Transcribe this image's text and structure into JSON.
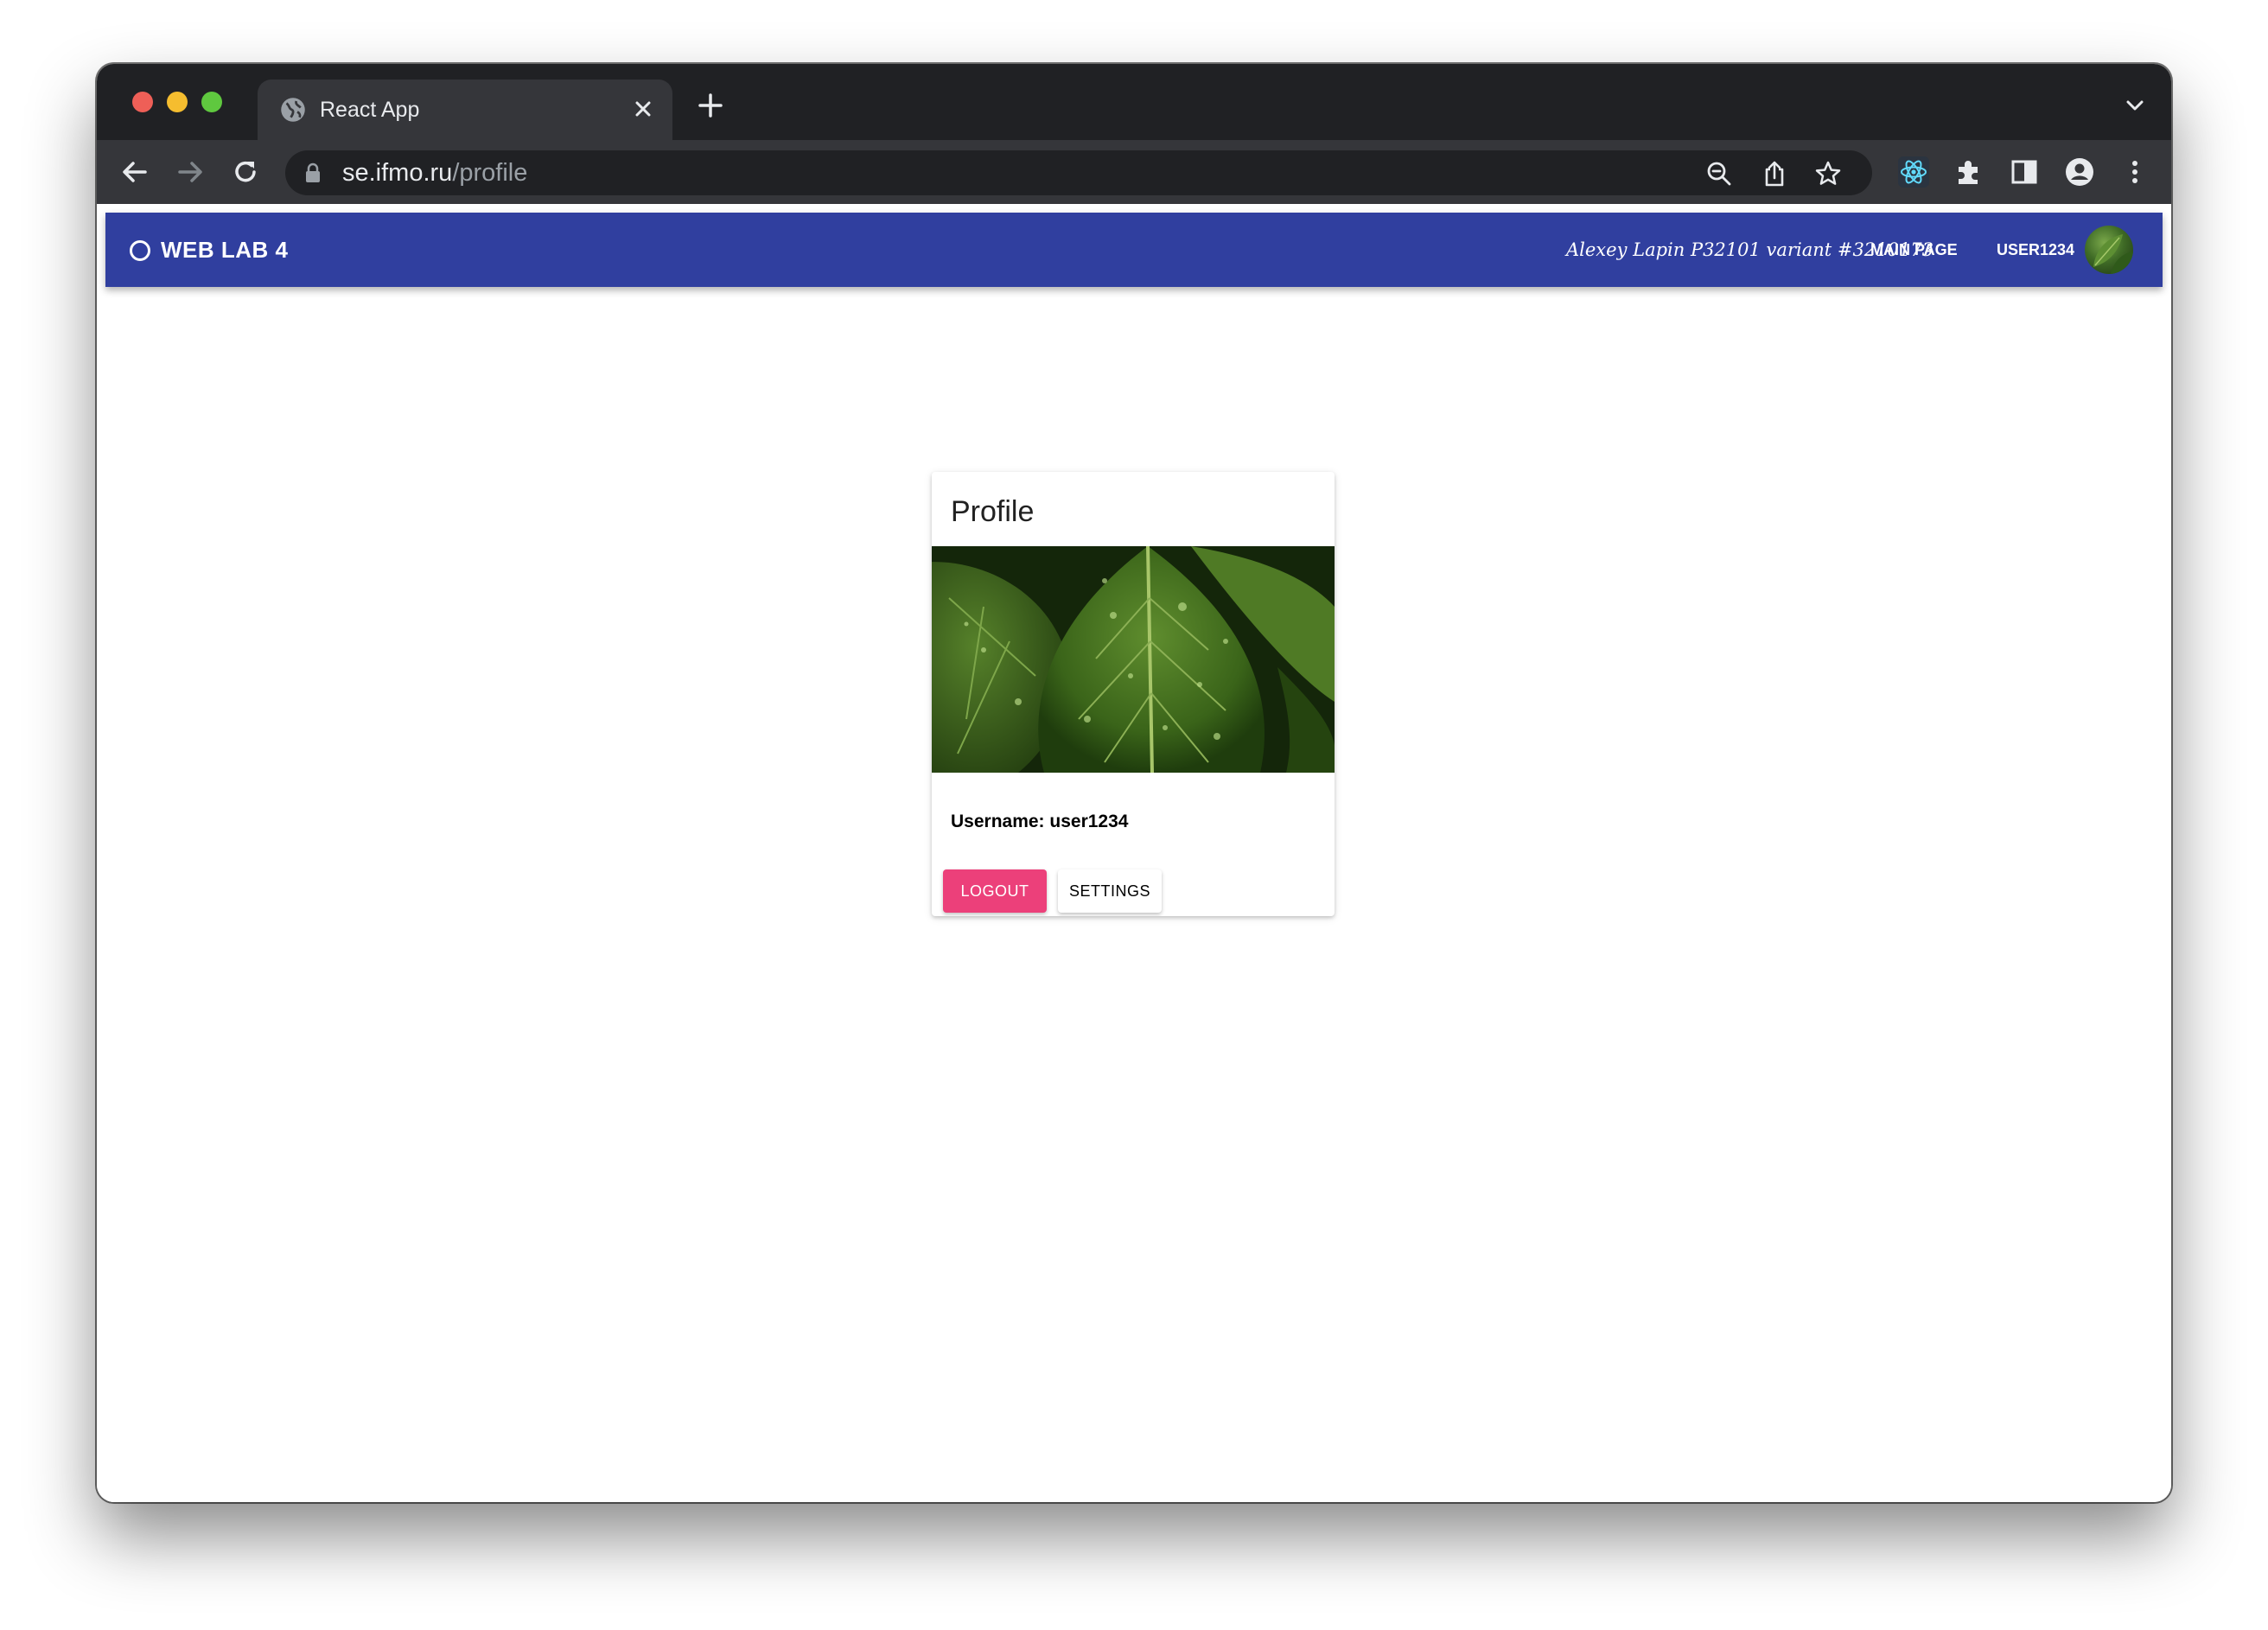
{
  "browser": {
    "tab_title": "React App",
    "url_host": "se.ifmo.ru",
    "url_path": "/profile",
    "icons": [
      "globe-icon",
      "close-icon",
      "plus-icon",
      "chevron-down-icon",
      "back-icon",
      "forward-icon",
      "reload-icon",
      "lock-icon",
      "zoom-icon",
      "share-icon",
      "star-icon",
      "react-devtools-icon",
      "extensions-icon",
      "side-panel-icon",
      "profile-icon",
      "more-icon"
    ]
  },
  "appbar": {
    "brand": "WEB LAB 4",
    "author": "Alexey Lapin P32101 variant #3210173",
    "nav_main": "MAIN PAGE",
    "nav_user": "USER1234",
    "color": "#303f9f"
  },
  "profile": {
    "title": "Profile",
    "username_label": "Username: user1234",
    "logout_label": "LOGOUT",
    "settings_label": "SETTINGS",
    "logout_color": "#ec407a"
  }
}
